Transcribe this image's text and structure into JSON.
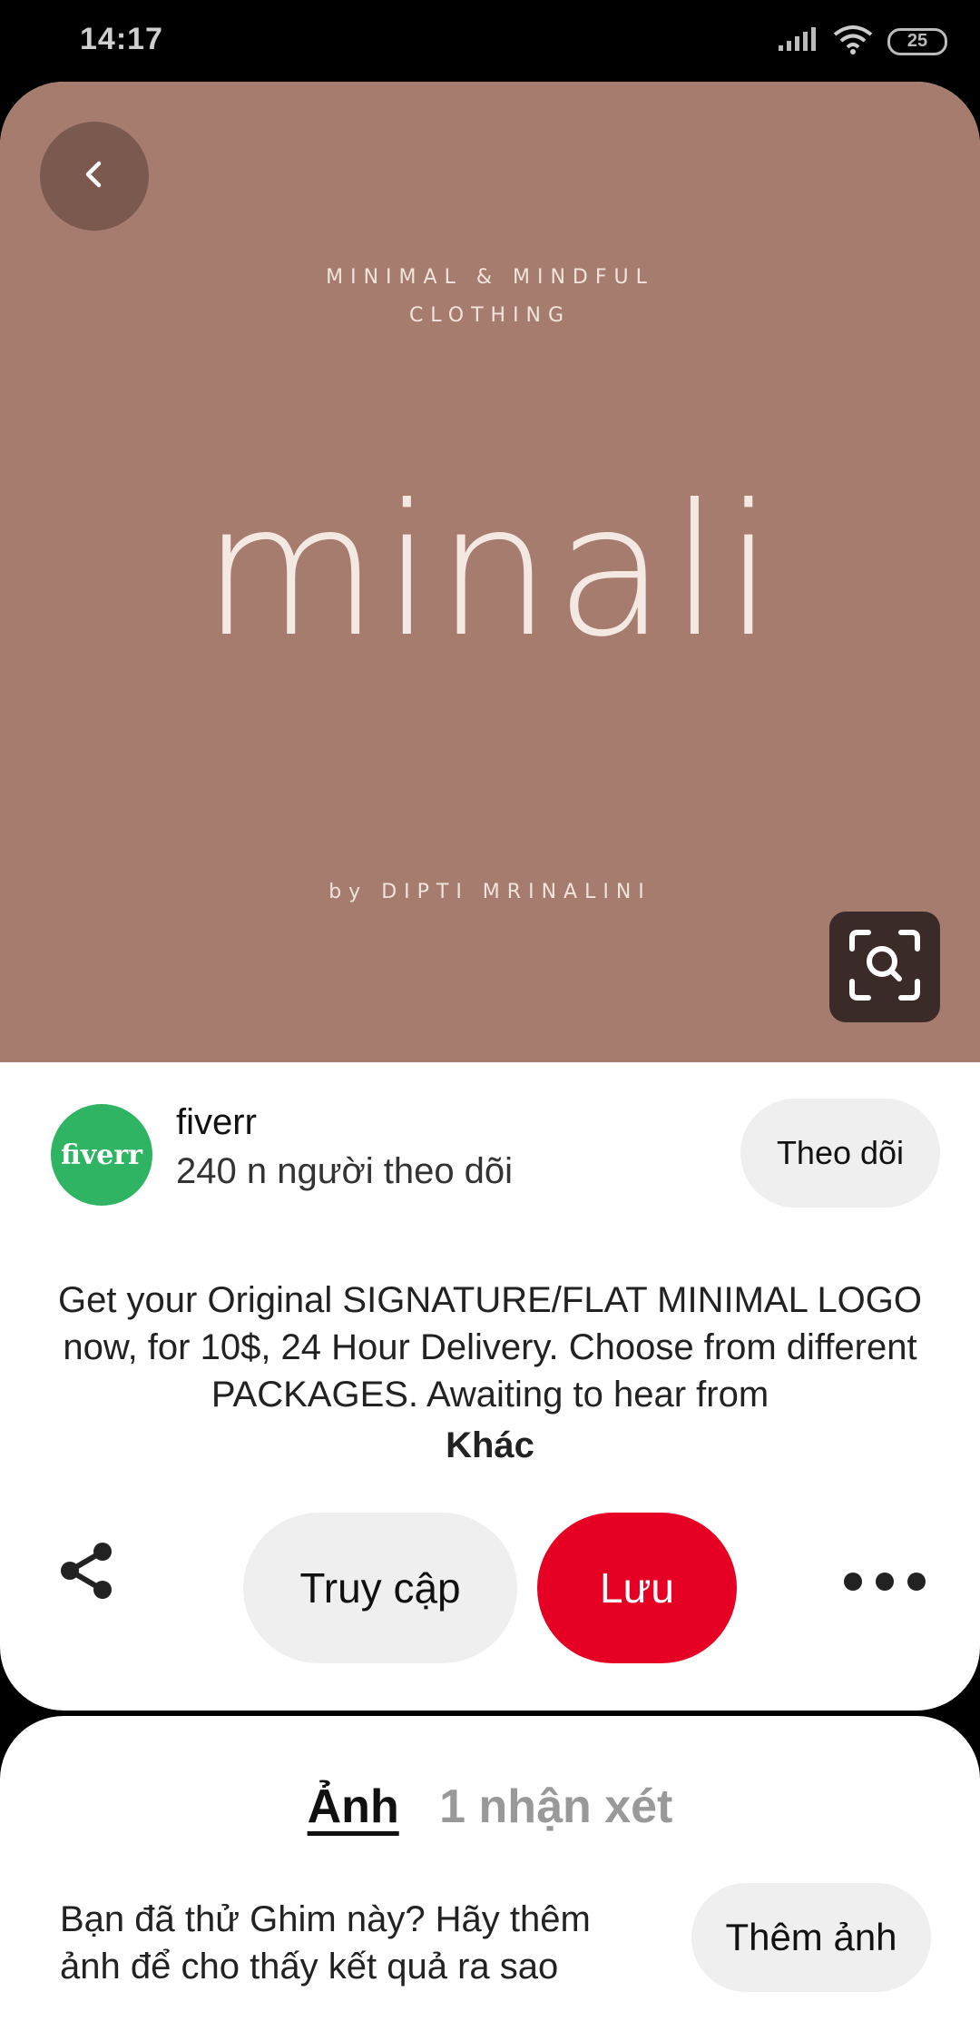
{
  "status_bar": {
    "time": "14:17",
    "battery": "25"
  },
  "pin_image": {
    "tagline_line1": "MINIMAL & MINDFUL",
    "tagline_line2": "CLOTHING",
    "brand": "minali",
    "credit": "by DIPTI MRINALINI",
    "background_color": "#a67c6e"
  },
  "creator": {
    "avatar_text": "fiverr",
    "name": "fiverr",
    "followers": "240 n người theo dõi",
    "follow_label": "Theo dõi"
  },
  "description": {
    "text": "Get your Original SIGNATURE/FLAT MINIMAL LOGO now, for 10$, 24 Hour Delivery. Choose from different PACKAGES. Awaiting to hear from",
    "more_label": "Khác"
  },
  "actions": {
    "visit_label": "Truy cập",
    "save_label": "Lưu",
    "accent_color": "#e60023"
  },
  "photos_section": {
    "tab_photos": "Ảnh",
    "tab_comments": "1 nhận xét",
    "prompt": "Bạn đã thử Ghim này? Hãy thêm ảnh để cho thấy kết quả ra sao",
    "add_photo_label": "Thêm ảnh"
  }
}
